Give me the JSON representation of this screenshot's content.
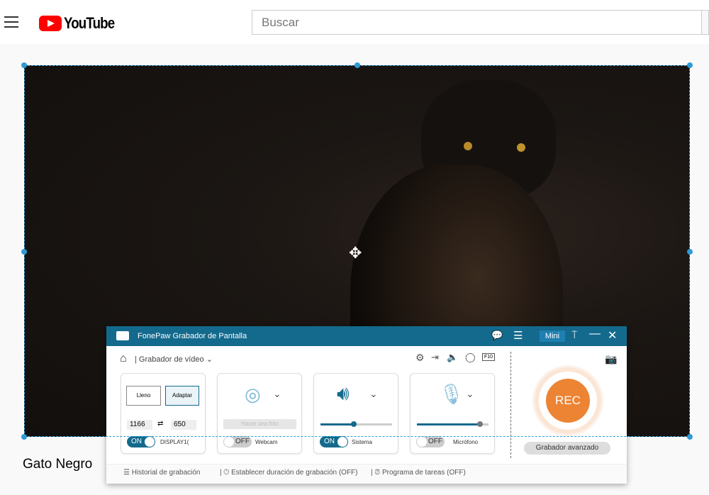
{
  "youtube": {
    "brand": "YouTube",
    "search_placeholder": "Buscar",
    "video_title": "Gato Negro"
  },
  "recorder": {
    "app_title": "FonePaw Grabador de Pantalla",
    "mini_label": "Mini",
    "mode": "Grabador de vídeo",
    "display": {
      "full_label": "Lleno",
      "fit_label": "Adaptar",
      "width": "1166",
      "height": "650",
      "toggle": "ON",
      "source": "DISPLAY1("
    },
    "webcam": {
      "photo_label": "Hacer una foto",
      "toggle": "OFF",
      "label": "Webcam"
    },
    "system": {
      "toggle": "ON",
      "label": "Sistema",
      "volume": 0.47
    },
    "mic": {
      "toggle": "OFF",
      "label": "Micrófono",
      "volume": 0.88
    },
    "rec_label": "REC",
    "advanced_label": "Grabador avanzado",
    "footer": {
      "history": "Historial de grabación",
      "duration": "Establecer duración de grabación (OFF)",
      "schedule": "Programa de tareas (OFF)"
    },
    "colors": {
      "accent": "#136a8d",
      "rec": "#ec8434"
    }
  }
}
